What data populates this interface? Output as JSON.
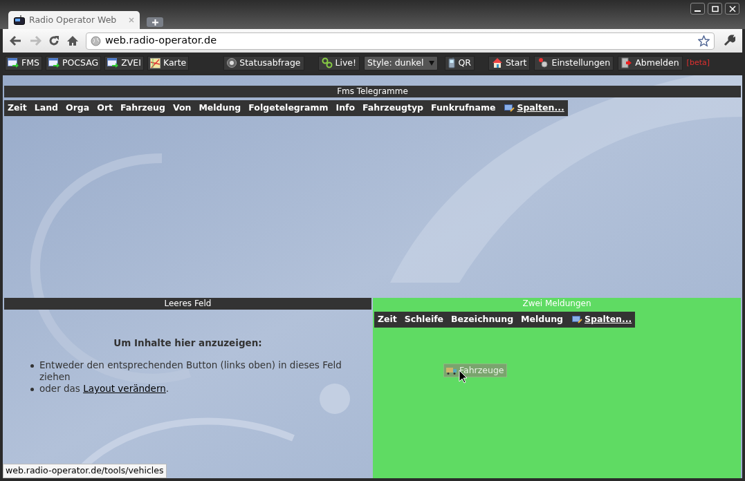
{
  "browser": {
    "tab_title": "Radio Operator Web",
    "url": "web.radio-operator.de",
    "status_url": "web.radio-operator.de/tools/vehicles"
  },
  "toolbar": {
    "left": [
      {
        "label": "FMS"
      },
      {
        "label": "POCSAG"
      },
      {
        "label": "ZVEI"
      },
      {
        "label": "Karte"
      }
    ],
    "right": [
      {
        "label": "Statusabfrage",
        "kind": "button"
      },
      {
        "label": "Live!",
        "kind": "button"
      },
      {
        "label": "Style: dunkel",
        "kind": "select"
      },
      {
        "label": "QR",
        "kind": "button"
      },
      {
        "label": "Start",
        "kind": "button"
      },
      {
        "label": "Einstellungen",
        "kind": "button"
      },
      {
        "label": "Abmelden",
        "kind": "button"
      }
    ],
    "beta": "[beta]"
  },
  "top_panel": {
    "title": "Fms Telegramme",
    "columns": [
      "Zeit",
      "Land",
      "Orga",
      "Ort",
      "Fahrzeug",
      "Von",
      "Meldung",
      "Folgetelegramm",
      "Info",
      "Fahrzeugtyp",
      "Funkrufname"
    ],
    "columns_link": "Spalten..."
  },
  "left_panel": {
    "title": "Leeres Feld",
    "heading": "Um Inhalte hier anzuzeigen:",
    "bullets": [
      {
        "text": "Entweder den entsprechenden Button (links oben) in dieses Feld ziehen"
      },
      {
        "text": "oder das ",
        "link": "Layout verändern",
        "after": "."
      }
    ]
  },
  "right_panel": {
    "title": "Zwei Meldungen",
    "highlighted": true,
    "columns": [
      "Zeit",
      "Schleife",
      "Bezeichnung",
      "Meldung"
    ],
    "columns_link": "Spalten..."
  },
  "drag_item": {
    "label": "Fahrzeuge"
  }
}
